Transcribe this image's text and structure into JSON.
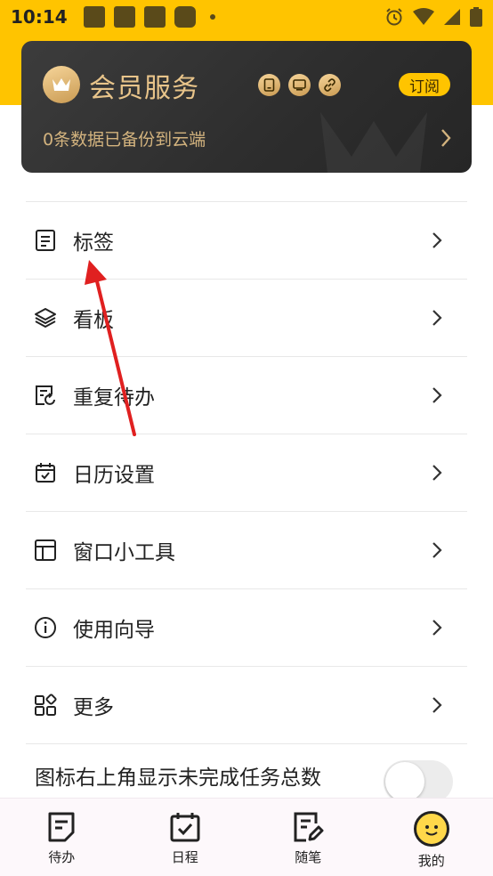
{
  "status_bar": {
    "time": "10:14"
  },
  "member_card": {
    "title": "会员服务",
    "subscribe_label": "订阅",
    "subtitle": "0条数据已备份到云端"
  },
  "menu": {
    "items": [
      {
        "label": "标签",
        "icon": "tag-list-icon"
      },
      {
        "label": "看板",
        "icon": "layers-icon"
      },
      {
        "label": "重复待办",
        "icon": "repeat-task-icon"
      },
      {
        "label": "日历设置",
        "icon": "calendar-check-icon"
      },
      {
        "label": "窗口小工具",
        "icon": "widget-layout-icon"
      },
      {
        "label": "使用向导",
        "icon": "info-icon"
      },
      {
        "label": "更多",
        "icon": "grid-more-icon"
      }
    ]
  },
  "badge_toggle": {
    "label": "图标右上角显示未完成任务总数",
    "enabled": false
  },
  "bottom_nav": {
    "items": [
      {
        "label": "待办",
        "icon": "todo-icon"
      },
      {
        "label": "日程",
        "icon": "schedule-icon"
      },
      {
        "label": "随笔",
        "icon": "note-icon"
      },
      {
        "label": "我的",
        "icon": "profile-avatar-icon"
      }
    ],
    "active_index": 3
  },
  "colors": {
    "accent": "#ffc400",
    "card_bg": "#2d2d2d",
    "gold_text": "#e8c48a",
    "annotation_arrow": "#e02020"
  }
}
